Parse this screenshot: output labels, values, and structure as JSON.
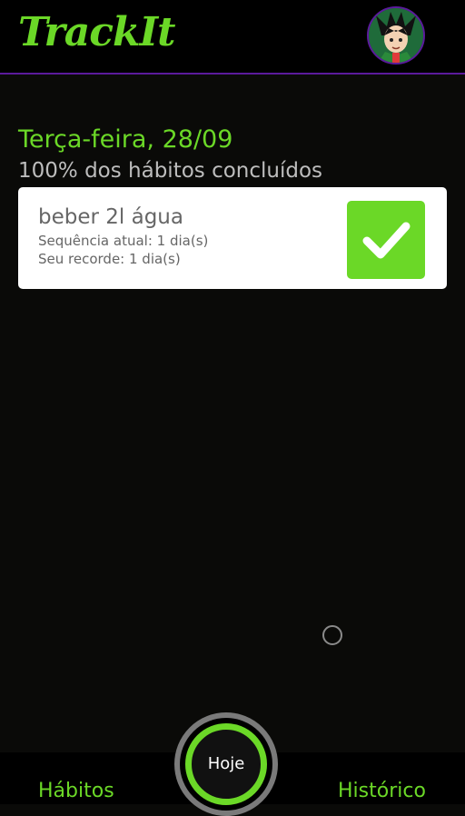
{
  "header": {
    "logo": "TrackIt",
    "avatar": "anime-character-avatar"
  },
  "today": {
    "date_title": "Terça-feira, 28/09",
    "progress_text": "100% dos hábitos concluídos"
  },
  "habits": [
    {
      "name": "beber 2l água",
      "current_streak": "Sequência atual: 1 dia(s)",
      "record": "Seu recorde: 1 dia(s)",
      "done": true
    }
  ],
  "footer": {
    "habits_label": "Hábitos",
    "today_label": "Hoje",
    "history_label": "Histórico"
  },
  "colors": {
    "accent": "#6bd827",
    "purple": "#5b1a9c",
    "background": "#0a0a08"
  }
}
